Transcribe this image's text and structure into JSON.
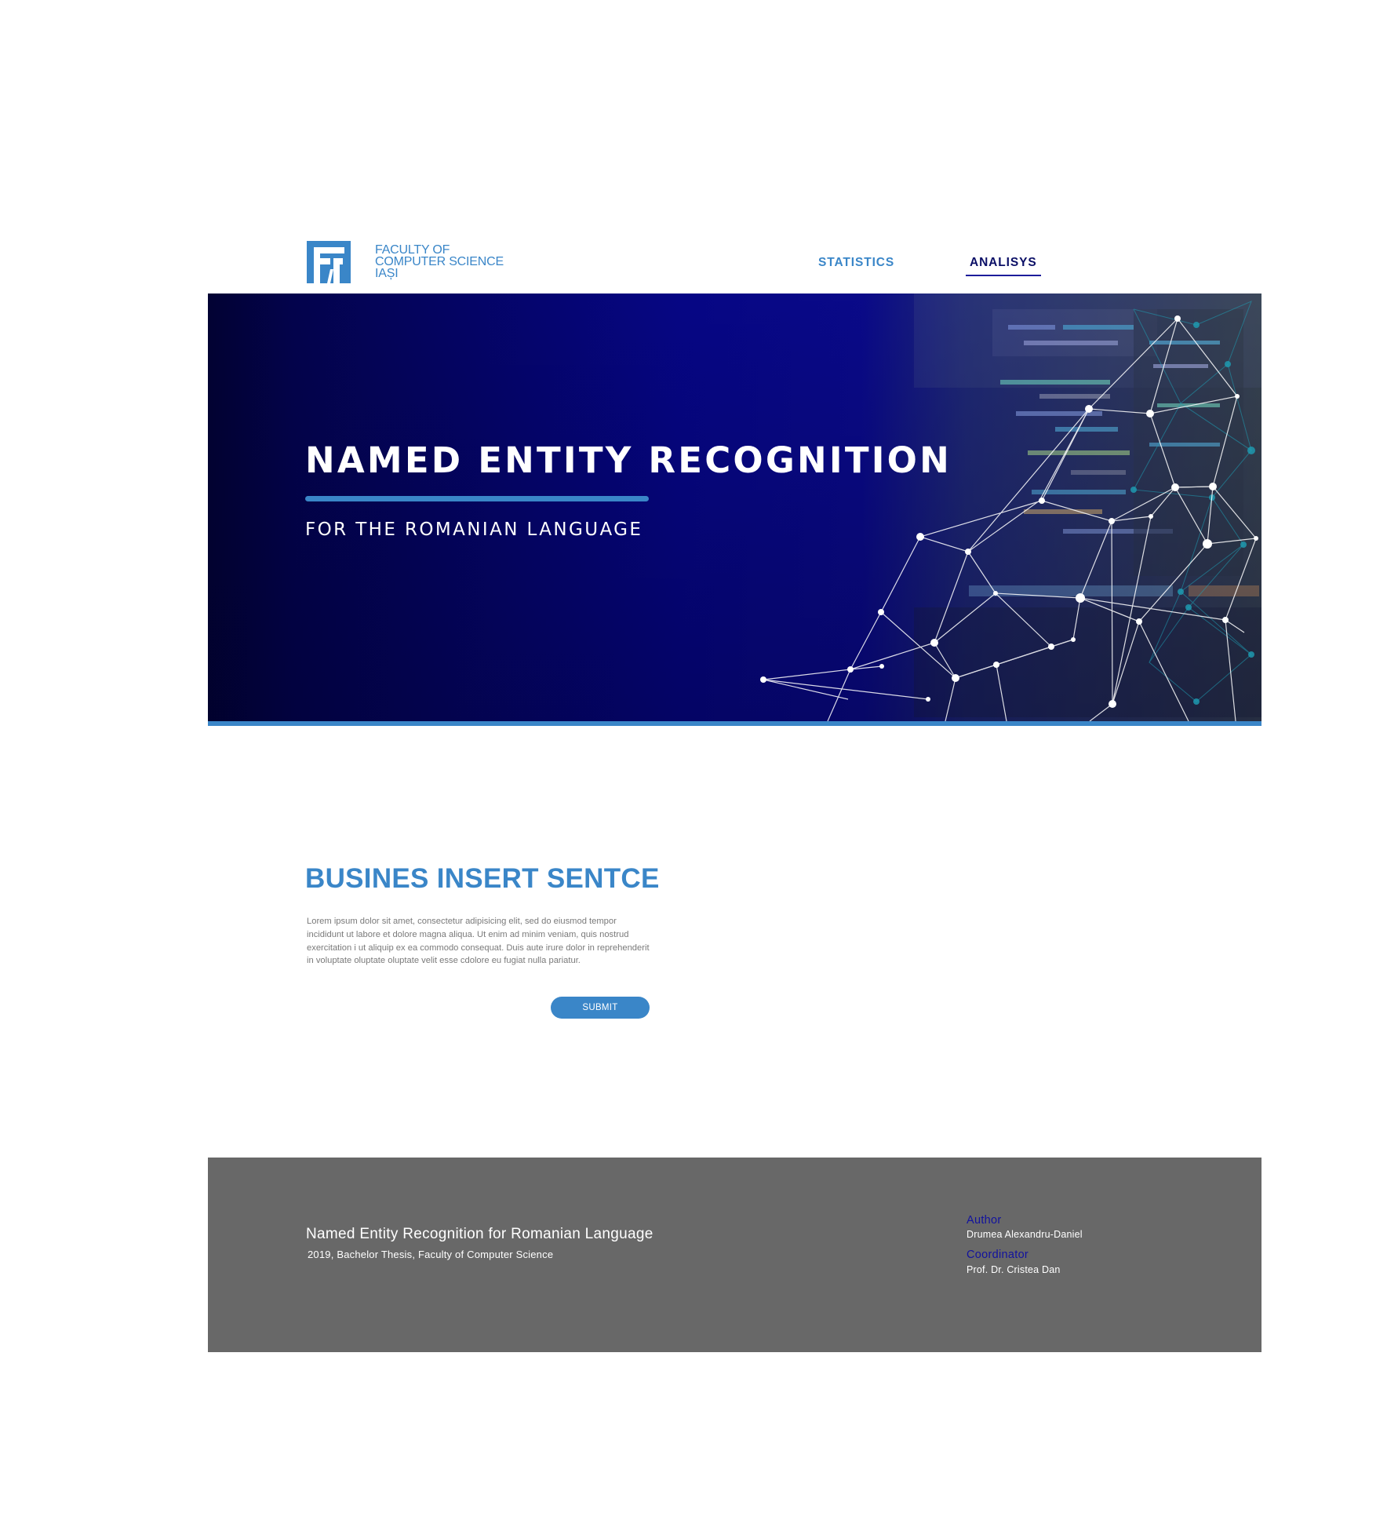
{
  "header": {
    "logo": {
      "icon": "faculty-logo-icon",
      "lines": [
        "FACULTY OF",
        "COMPUTER SCIENCE",
        "IAȘI"
      ]
    },
    "nav": [
      {
        "label": "STATISTICS",
        "active": false
      },
      {
        "label": "ANALISYS",
        "active": true
      }
    ]
  },
  "hero": {
    "title": "NAMED ENTITY RECOGNITION",
    "subtitle": "FOR THE ROMANIAN LANGUAGE"
  },
  "main": {
    "title": "BUSINES INSERT SENTCE",
    "body": "Lorem ipsum dolor sit amet, consectetur adipisicing elit, sed do eiusmod tempor incididunt ut labore et dolore magna aliqua. Ut enim ad minim veniam, quis nostrud exercitation i ut aliquip ex ea commodo consequat. Duis aute irure dolor in reprehenderit in voluptate oluptate oluptate velit esse cdolore eu fugiat nulla pariatur.",
    "submit_label": "SUBMIT"
  },
  "footer": {
    "title": "Named Entity Recognition for Romanian Language",
    "subtitle": "2019, Bachelor Thesis, Faculty of Computer Science",
    "author_label": "Author",
    "author_name": "Drumea Alexandru-Daniel",
    "coordinator_label": "Coordinator",
    "coordinator_name": "Prof. Dr. Cristea Dan"
  },
  "colors": {
    "accent": "#3a86c8",
    "nav_active": "#0b0f66",
    "hero_dark": "#020234",
    "hero_blue": "#06068a",
    "footer_bg": "#686868",
    "footer_label": "#12129e"
  }
}
